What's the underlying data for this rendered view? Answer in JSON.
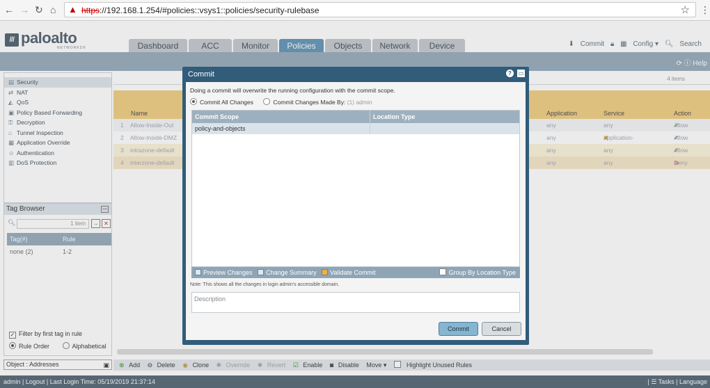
{
  "browser": {
    "url_https": "https",
    "url_rest": "://192.168.1.254/#policies::vsys1::policies/security-rulebase"
  },
  "app": {
    "logo_text": "paloalto",
    "logo_sub": "NETWORKS®",
    "tabs": [
      "Dashboard",
      "ACC",
      "Monitor",
      "Policies",
      "Objects",
      "Network",
      "Device"
    ],
    "active_tab": "Policies",
    "header_actions": {
      "commit": "Commit",
      "config": "Config ▾",
      "search": "Search"
    },
    "help": "Help"
  },
  "left_nav": {
    "items": [
      "Security",
      "NAT",
      "QoS",
      "Policy Based Forwarding",
      "Decryption",
      "Tunnel Inspection",
      "Application Override",
      "Authentication",
      "DoS Protection"
    ]
  },
  "tag_browser": {
    "title": "Tag Browser",
    "search_count": "1 item",
    "col_tag": "Tag(#)",
    "col_rule": "Rule",
    "row_tag": "none (2)",
    "row_rule": "1-2",
    "filter_label": "Filter by first tag in rule",
    "rule_order": "Rule Order",
    "alphabetical": "Alphabetical"
  },
  "object_bar": "Object : Addresses",
  "grid": {
    "items_count": "4 items",
    "headers": {
      "name": "Name",
      "application": "Application",
      "service": "Service",
      "action": "Action"
    },
    "rows": [
      {
        "num": "1",
        "name": "Allow-Inside-Out",
        "application": "any",
        "service": "any",
        "action": "Allow"
      },
      {
        "num": "2",
        "name": "Allow-Inside-DMZ",
        "application": "any",
        "service": "application-default",
        "action": "Allow"
      },
      {
        "num": "3",
        "name": "intrazone-default",
        "application": "any",
        "service": "any",
        "action": "Allow"
      },
      {
        "num": "4",
        "name": "interzone-default",
        "application": "any",
        "service": "any",
        "action": "Deny"
      }
    ]
  },
  "toolbar": [
    "Add",
    "Delete",
    "Clone",
    "Override",
    "Revert",
    "Enable",
    "Disable",
    "Move ▾",
    "Highlight Unused Rules"
  ],
  "status_bar": {
    "user": "admin",
    "logout": "Logout",
    "last_login": "Last Login Time: 05/19/2019 21:37:14",
    "tasks": "Tasks",
    "language": "Language"
  },
  "modal": {
    "title": "Commit",
    "info": "Doing a commit will overwrite the running configuration with the commit scope.",
    "radio_all": "Commit All Changes",
    "radio_by": "Commit Changes Made By:",
    "radio_by_value": "(1) admin",
    "col_scope": "Commit Scope",
    "col_location": "Location Type",
    "row_scope": "policy-and-objects",
    "row_location": "",
    "actions": {
      "preview": "Preview Changes",
      "summary": "Change Summary",
      "validate": "Validate Commit",
      "group": "Group By Location Type"
    },
    "note": "Note: This shows all the changes in login admin's accessible domain.",
    "description_placeholder": "Description",
    "commit_button": "Commit",
    "cancel_button": "Cancel"
  }
}
